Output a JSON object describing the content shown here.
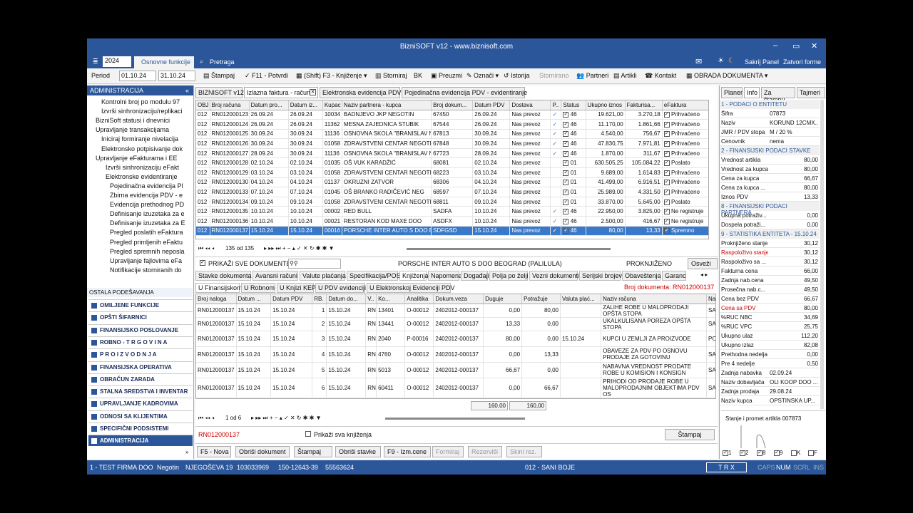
{
  "window": {
    "title": "BizniSOFT v12 - www.biznisoft.com",
    "min": "–",
    "max": "▭",
    "close": "✕"
  },
  "menu": {
    "year": "2024",
    "tab_active": "Osnovne funkcije",
    "search": "Pretraga",
    "hide_panel": "Sakrij Panel",
    "close_forms": "Zatvori forme"
  },
  "toolbar": {
    "period_label": "Period",
    "date_from": "01.10.24",
    "date_to": "31.10.24",
    "print": "Štampaj",
    "confirm": "F11 - Potvrdi",
    "posting": "(Shift) F3 - Knjiženje",
    "cancel": "Storniraj",
    "bk": "BK",
    "download": "Preuzmi",
    "mark": "Označi",
    "history": "Istorija",
    "canceled": "Stornirano",
    "partners": "Partneri",
    "articles": "Artikli",
    "contact": "Kontakt",
    "doc_processing": "OBRADA DOKUMENTA"
  },
  "left": {
    "header": "ADMINISTRACIJA",
    "tree": [
      "Kontrolni broj po modulu 97",
      "Izvrši sinhronizaciju/replikaci",
      "BizniSoft statusi i dnevnici",
      "Upravljanje transakcijama",
      "Iniciraj formiranje nivelacija",
      "Elektronsko potpisivanje dok",
      "Upravljanje eFakturama i EE",
      "Izvrši sinhronizaciju eFakt",
      "Elektronske evidentiranje",
      "Pojedinačna evidencija Pl",
      "Zbirna evidencija PDV - e",
      "Evidencija prethodnog PD",
      "Definisanje izuzetaka za e",
      "Definisanje izuzetaka za E",
      "Pregled poslatih eFaktura",
      "Pregled primljenih eFaktu",
      "Pregled spremnih neposla",
      "Upravljanje fajlovima eFa",
      "Notifikacije storniranih do"
    ],
    "other_settings": "OSTALA PODEŠAVANJA",
    "nav": [
      "OMILJENE FUNKCIJE",
      "OPŠTI ŠIFARNICI",
      "FINANSIJSKO POSLOVANJE",
      "ROBNO - T R G O V I N A",
      "P R O I Z V O D N J A",
      "FINANSIJSKA OPERATIVA",
      "OBRAČUN ZARADA",
      "STALNA SREDSTVA I INVENTAR",
      "UPRAVLJANJE KADROVIMA",
      "ODNOSI SA KLIJENTIMA",
      "SPECIFIČNI PODSISTEMI",
      "ADMINISTRACIJA"
    ]
  },
  "doc_tabs": [
    "BIZNISOFT v12",
    "Izlazna faktura - račun",
    "Elektronska evidencija PDV",
    "Pojedinačna evidencija PDV - evidentiranje"
  ],
  "invoices": {
    "headers": [
      "OBJ",
      "Broj računa",
      "Datum pro...",
      "Datum iz...",
      "Kupac",
      "Naziv partnera - kupca",
      "Broj dokum...",
      "Datum PDV",
      "Dostava",
      "P..",
      "Status",
      "Ukupno iznos",
      "Fakturisa...",
      "eFaktura"
    ],
    "rows": [
      [
        "012",
        "RN012000123",
        "26.09.24",
        "26.09.24",
        "10034",
        "BADNJEVO JKP NEGOTIN",
        "67450",
        "26.09.24",
        "Nas prevoz",
        "✓",
        "46",
        "19.621,00",
        "3.270,18",
        "Prihvaćeno"
      ],
      [
        "012",
        "RN012000124",
        "26.09.24",
        "26.09.24",
        "11362",
        "MESNA ZAJEDNICA STUBIK",
        "67544",
        "26.09.24",
        "Nas prevoz",
        "✓",
        "46",
        "11.170,00",
        "1.861,66",
        "Prihvaćeno"
      ],
      [
        "012",
        "RN012000125",
        "30.09.24",
        "30.09.24",
        "11136",
        "OSNOVNA SKOLA \"BRANISLAV NUS",
        "67813",
        "30.09.24",
        "Nas prevoz",
        "✓",
        "46",
        "4.540,00",
        "756,67",
        "Prihvaćeno"
      ],
      [
        "012",
        "RN012000126",
        "30.09.24",
        "30.09.24",
        "01058",
        "ZDRAVSTVENI CENTAR NEGOTIN",
        "67848",
        "30.09.24",
        "Nas prevoz",
        "✓",
        "46",
        "47.830,75",
        "7.971,81",
        "Prihvaćeno"
      ],
      [
        "012",
        "RN012000127",
        "28.09.24",
        "30.09.24",
        "11136",
        "OSNOVNA SKOLA \"BRANISLAV NUS",
        "67723",
        "28.09.24",
        "Nas prevoz",
        "✓",
        "46",
        "1.870,00",
        "311,67",
        "Prihvaćeno"
      ],
      [
        "012",
        "RN012000128",
        "02.10.24",
        "02.10.24",
        "01035",
        "OŠ VUK KARADŽIĆ",
        "68081",
        "02.10.24",
        "Nas prevoz",
        "",
        "01",
        "630.505,25",
        "105.084,22",
        "Poslato"
      ],
      [
        "012",
        "RN012000129",
        "03.10.24",
        "03.10.24",
        "01058",
        "ZDRAVSTVENI CENTAR NEGOTIN",
        "68223",
        "03.10.24",
        "Nas prevoz",
        "",
        "01",
        "9.689,00",
        "1.614,83",
        "Prihvaćeno"
      ],
      [
        "012",
        "RN012000130",
        "04.10.24",
        "04.10.24",
        "01137",
        "OKRUZNI ZATVOR",
        "68306",
        "04.10.24",
        "Nas prevoz",
        "",
        "01",
        "41.499,00",
        "6.916,51",
        "Prihvaćeno"
      ],
      [
        "012",
        "RN012000133",
        "07.10.24",
        "07.10.24",
        "01045",
        "OŠ BRANKO RADIČEVIĆ NEG",
        "68597",
        "07.10.24",
        "Nas prevoz",
        "",
        "01",
        "25.989,00",
        "4.331,50",
        "Prihvaćeno"
      ],
      [
        "012",
        "RN012000134",
        "09.10.24",
        "09.10.24",
        "01058",
        "ZDRAVSTVENI CENTAR NEGOTIN",
        "68811",
        "09.10.24",
        "Nas prevoz",
        "",
        "01",
        "33.870,00",
        "5.645,00",
        "Poslato"
      ],
      [
        "012",
        "RN012000135",
        "10.10.24",
        "10.10.24",
        "00002",
        "RED BULL",
        "SADFA",
        "10.10.24",
        "Nas prevoz",
        "✓",
        "46",
        "22.950,00",
        "3.825,00",
        "Ne registruje"
      ],
      [
        "012",
        "RN012000136",
        "10.10.24",
        "10.10.24",
        "00021",
        "RESTORAN KOD MAXE DOO",
        "ASDFX",
        "10.10.24",
        "Nas prevoz",
        "✓",
        "46",
        "2.500,00",
        "416,67",
        "Ne registruje"
      ],
      [
        "012",
        "RN012000137",
        "15.10.24",
        "15.10.24",
        "00016",
        "PORSCHE INTER AUTO S DOO BEO",
        "SDFGSD",
        "15.10.24",
        "Nas prevoz",
        "✓",
        "46",
        "80,00",
        "13,33",
        "Spremno"
      ]
    ]
  },
  "nav_record": "135 od 135",
  "show_all_docs": "PRIKAŽI SVE DOKUMENTE",
  "partner_name": "PORSCHE INTER AUTO S DOO BEOGRAD (PALILULA)",
  "posted_status": "PROKNJIŽENO",
  "refresh": "Osveži",
  "subtabs": [
    "Stavke dokumenta",
    "Avansni računi",
    "Valute plaćanja",
    "Specifikacija/POS",
    "Knjiženja",
    "Napomena",
    "Događaji",
    "Polja po želji",
    "Vezni dokumenti",
    "Serijski brojevi",
    "Obaveštenja",
    "Garanc"
  ],
  "subtabs2": [
    "U Finansijskom",
    "U Robnom",
    "U Knjizi KEP",
    "U PDV evidenciji",
    "U Elektronskoj Evidenciji PDV"
  ],
  "doc_number_label": "Broj dokumenta: RN012000137",
  "postings": {
    "headers": [
      "Broj naloga",
      "Datum ...",
      "Datum PDV",
      "RB.",
      "Datum do...",
      "V..",
      "Ko...",
      "Analitika",
      "Dokum.veza",
      "Duguje",
      "Potražuje",
      "Valuta plać...",
      "Naziv računa",
      "Na"
    ],
    "rows": [
      [
        "RN012000137",
        "15.10.24",
        "15.10.24",
        "1",
        "15.10.24",
        "RN",
        "13401",
        "O-00012",
        "2402012-000137",
        "0,00",
        "80,00",
        "",
        "ZALIHE ROBE U MALOPRODAJI OPŠTA STOPA",
        "SA"
      ],
      [
        "RN012000137",
        "15.10.24",
        "15.10.24",
        "2",
        "15.10.24",
        "RN",
        "13441",
        "O-00012",
        "2402012-000137",
        "13,33",
        "0,00",
        "",
        "UKALKULISANA POREZA OPŠTA STOPA",
        "SA"
      ],
      [
        "RN012000137",
        "15.10.24",
        "15.10.24",
        "3",
        "15.10.24",
        "RN",
        "2040",
        "P-00016",
        "2402012-000137",
        "80,00",
        "0,00",
        "15.10.24",
        "KUPCI U ZEMLJI ZA PROIZVODE",
        "PO"
      ],
      [
        "RN012000137",
        "15.10.24",
        "15.10.24",
        "4",
        "15.10.24",
        "RN",
        "4760",
        "O-00012",
        "2402012-000137",
        "0,00",
        "13,33",
        "",
        "OBAVEZE ZA PDV PO OSNOVU PRODAJE ZA GOTOVINU",
        "SA"
      ],
      [
        "RN012000137",
        "15.10.24",
        "15.10.24",
        "5",
        "15.10.24",
        "RN",
        "5013",
        "O-00012",
        "2402012-000137",
        "66,67",
        "0,00",
        "",
        "NABAVNA VREDNOST PRODATE ROBE U KOMISION I KONSIGN",
        "SA"
      ],
      [
        "RN012000137",
        "15.10.24",
        "15.10.24",
        "6",
        "15.10.24",
        "RN",
        "60411",
        "O-00012",
        "2402012-000137",
        "0,00",
        "66,67",
        "",
        "PRIHODI OD PRODAJE ROBE U MALOPRODAJNIM OBJEKTIMA PDV OS",
        "SA"
      ]
    ],
    "total_debit": "160,00",
    "total_credit": "160,00"
  },
  "nav_sub": "1 od 6",
  "doc_no_footer": "RN012000137",
  "show_all_postings": "Prikaži sva knjiženja",
  "print_btn": "Štampaj",
  "bottom_btns": [
    "F5 - Nova",
    "Obriši dokument",
    "Štampaj",
    "Obriši stavke",
    "F9 - Izm.cene",
    "Formiraj",
    "Rezerviši",
    "Skini rez."
  ],
  "right": {
    "tabs": [
      "Planer",
      "Info",
      "Za štampu",
      "Tajmeri"
    ],
    "sec1": "1 - PODACI O ENTITETU",
    "ent": [
      [
        "Šifra",
        "07873"
      ],
      [
        "Naziv",
        "KORUND 12CMX..."
      ],
      [
        "JMR / PDV stopa",
        "M / 20 %"
      ],
      [
        "Cenovnik",
        "nema"
      ]
    ],
    "sec2": "2 - FINANSIJSKI PODACI STAVKE",
    "fin": [
      [
        "Vrednost artikla",
        "80,00"
      ],
      [
        "Vrednost za kupca",
        "80,00"
      ],
      [
        "Cena za kupca",
        "66,67"
      ],
      [
        "Cena za kupca ...",
        "80,00"
      ],
      [
        "Iznos PDV",
        "13,33"
      ]
    ],
    "sec8": "8 - FINANSIJSKI PODACI PARTNERA",
    "par": [
      [
        "Ukupna potraživ...",
        "0,00"
      ],
      [
        "Dospela potraži...",
        "0,00"
      ]
    ],
    "sec9": "9 - STATISTIKA ENTITETA - 15.10.24",
    "stat": [
      [
        "Proknjiženo stanje",
        "30,12"
      ],
      [
        "Raspoloživo stanje",
        "30,12"
      ],
      [
        "Raspoloživo sa ...",
        "30,12"
      ],
      [
        "Fakturna cena",
        "66,00"
      ],
      [
        "Zadnja nab.cena",
        "49,50"
      ],
      [
        "Prosečna nab.c...",
        "49,50"
      ],
      [
        "Cena bez PDV",
        "66,67"
      ],
      [
        "Cena sa PDV",
        "80,00"
      ],
      [
        "%RUC NBC",
        "34,69"
      ],
      [
        "%RUC VPC",
        "25,75"
      ],
      [
        "Ukupno ulaz",
        "112,20"
      ],
      [
        "Ukupno izlaz",
        "82,08"
      ],
      [
        "Prethodna nedelja",
        "0,00"
      ],
      [
        "Pre 4 nedelje",
        "0,50"
      ],
      [
        "Zadnja nabavka",
        "02.09.24"
      ],
      [
        "Naziv dobavljača",
        "OLI KOOP DOO ..."
      ],
      [
        "Zadnja prodaja",
        "29.08.24"
      ],
      [
        "Naziv kupca",
        "OPSTINSKA UP..."
      ]
    ],
    "chart_title": "Stanje i promet artikla 007873",
    "chart_checks": [
      "1",
      "2",
      "8",
      "9",
      "K",
      "F"
    ]
  },
  "status": {
    "company": "1 - TEST FIRMA DOO",
    "city": "Negotin",
    "street": "NJEGOŠEVA 19",
    "pib": "103033969",
    "account": "150-12643-39",
    "phone": "55563624",
    "warehouse": "012 - SANI BOJE",
    "mode": "T R X",
    "caps": "CAPS",
    "num": "NUM",
    "scrl": "SCRL",
    "ins": "INS"
  }
}
